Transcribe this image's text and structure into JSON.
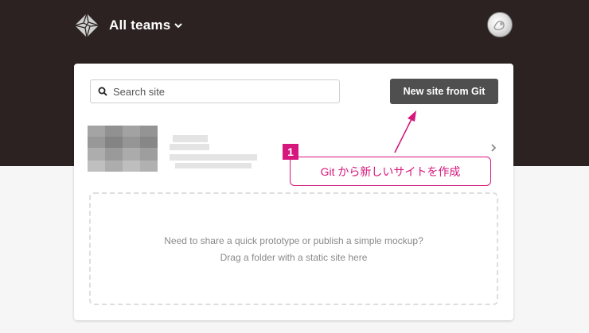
{
  "header": {
    "team_switcher_label": "All teams"
  },
  "search": {
    "placeholder": "Search site"
  },
  "actions": {
    "new_site_label": "New site from Git"
  },
  "dropzone": {
    "line1": "Need to share a quick prototype or publish a simple mockup?",
    "line2": "Drag a folder with a static site here"
  },
  "annotation": {
    "number": "1",
    "text": "Git から新しいサイトを作成"
  },
  "icons": {
    "logo": "netlify-logo-icon",
    "team_dropdown": "chevron-down-icon",
    "avatar": "user-avatar",
    "search": "search-icon",
    "row_open": "chevron-right-icon"
  },
  "colors": {
    "header_bg": "#2b2221",
    "annotation": "#d6177d",
    "button_bg": "#4f4f4f"
  }
}
